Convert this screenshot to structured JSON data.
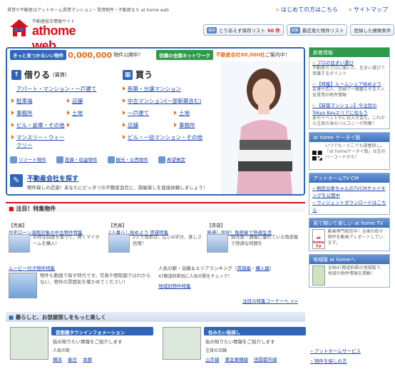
{
  "top": {
    "tagline": "賃貸や不動産はアットホーム賃貸マンション・賃貸物件・不動産なら at home web",
    "links": [
      "はじめての方はこちら",
      "サイトマップ"
    ]
  },
  "logo": {
    "tag": "不動産総合情報サイト",
    "name": "athome web"
  },
  "savebar": {
    "save": "とりあえず保存リスト",
    "save_icon": "保存",
    "save_count": "50 件",
    "recent": "最近見た物件リスト",
    "recent_icon": "閲覧",
    "search": "登録した検索条件"
  },
  "banner": {
    "left_pill": "きっと見つかるいい物件",
    "left_count": "0,000,000",
    "left_unit": "物件",
    "left_text": "公開中！",
    "right_pill": "信頼の全国ネットワーク",
    "right_text": "不動産会社00,000社",
    "right_text2": "ご案内中！"
  },
  "kariru": {
    "title": "借りる",
    "sub": "(賃貸)",
    "items": [
      "アパート・マンション・一戸建て",
      "駐車場",
      "店舗",
      "事務所",
      "土地",
      "ビル・倉庫・その他",
      "マンスリー・ウィークリー"
    ]
  },
  "kau": {
    "title": "買う",
    "items": [
      "新築・分譲マンション",
      "中古マンション(一部新築含む)",
      "一戸建て",
      "土地",
      "店舗",
      "事務所",
      "ビル・一括マンション・その他"
    ]
  },
  "minor": [
    "リゾート物件",
    "投資・収益物件",
    "観光・公売物件",
    "希望買定"
  ],
  "agent": {
    "title": "不動産会社を探す",
    "desc": "物件探しの近道！あなたにピッタリの不動産会社に、部屋探しを直接依頼しましょう！"
  },
  "news": {
    "head": "新着情報",
    "items": [
      {
        "l": "プロの住まい選び",
        "s": "不動産のプロに聞いた、住まい選びで意識するポイント"
      },
      {
        "l": "【特集】ルームシェア始めよう",
        "s": "友達や恋人、夫婦で一緒暮らせる人人気賃貸の物件情報"
      },
      {
        "l": "【新築マンション】今注目の Tokyo Bayエリアに住もう",
        "s": "夏のイベントやに花火大会も。これから注目の海のバルコニーが特集！"
      }
    ]
  },
  "mobile": {
    "head": "at home ケータイ版",
    "text": "いつでも・どこでも部屋探し。「at homeケータイ版」は左のバーコードから！"
  },
  "tvcm": {
    "head": "アットホームTV CM",
    "items": [
      "桐武谷季ちゃんのTVCMやメイキングを公開中",
      "ウィジェットダウンロードはこちら"
    ]
  },
  "tv": {
    "head": "見て聞いて楽しい at home TV",
    "logo": "at home TV",
    "text": "動画専門配信中！全国の街や物件を動画でレポートしています。"
  },
  "region": {
    "head": "地域版 at homeへ",
    "text": "全国47都道府県の地域版で、地域の物件情報を掲載！"
  },
  "rlinks": [
    "アットホームサービス",
    "物件を探しの方"
  ],
  "tokushu": "注目！特集物件",
  "features": [
    {
      "label": "【売買】",
      "link": "住宅ローン減税対象の中古物件特集",
      "text": "お得な制度を使って、賢くマイホームを購入！"
    },
    {
      "label": "【売買】",
      "link": "2人暮らし始めよう 賃貸特集",
      "text": "2人で住めば、広い&学分、楽しさ倍増！"
    },
    {
      "label": "【賃貸】",
      "link": "風通し良好！角部屋で快適生活",
      "text": "採光面・通風に優れている角部屋で快適な時間を"
    }
  ],
  "movie": {
    "link": "ムービー付き物件特集",
    "text": "物件も動画で探す時代です。写真や間取図ではわからない、物件の雰囲気を確かめてください！"
  },
  "spots": {
    "t1": "人気の駅・沿線＆エリアランキング（",
    "l1": "賃貸編",
    "sep": "・",
    "l2": "購入編",
    "t2": "）",
    "t3": "47都道府県別に人気の駅をチェック！",
    "l3": "地域別物件特集"
  },
  "more": "注目の特集コーナーへ >>",
  "kurashi": "暮らしと、お部屋探しをもっと楽しく",
  "k1": {
    "head": "首都圏タウンインフォメーション",
    "text": "街の知りたい情報をご紹介します",
    "sub": "人気の街",
    "links": "横浜",
    "l2": "春日",
    "l3": "本郷"
  },
  "k2": {
    "head": "住みたい街探し",
    "text": "街の知りたい情報をご紹介します",
    "sub": "注目の沿線",
    "links": "山手線",
    "l2": "東急東横線",
    "l3": "田園都市線"
  }
}
